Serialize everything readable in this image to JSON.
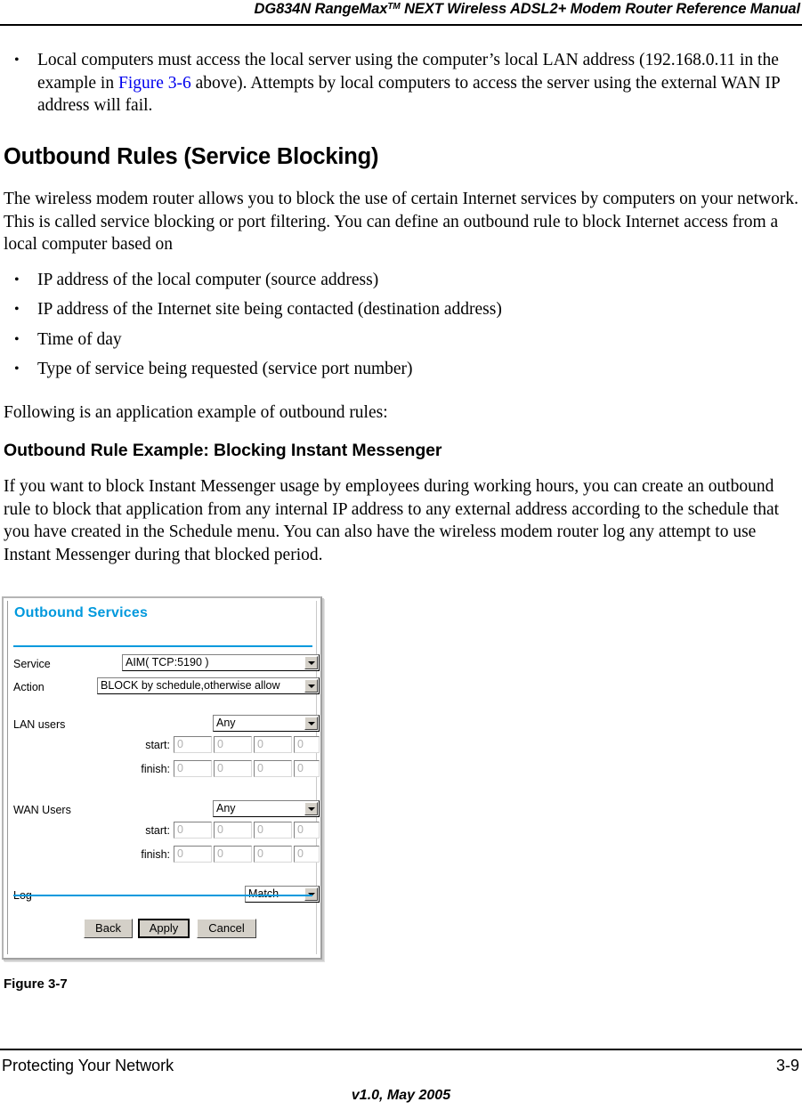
{
  "header": {
    "title_prefix": "DG834N RangeMax",
    "title_sup": "TM",
    "title_suffix": " NEXT Wireless ADSL2+ Modem Router Reference Manual"
  },
  "intro_bullet": {
    "part1": "Local computers must access the local server using the computer’s local LAN address (192.168.0.11 in the example in ",
    "link": "Figure 3-6",
    "part2": " above). Attempts by local computers to access the server using the external WAN IP address will fail."
  },
  "section": {
    "heading": "Outbound Rules (Service Blocking)",
    "intro": "The wireless modem router allows you to block the use of certain Internet services by computers on your network. This is called service blocking or port filtering. You can define an outbound rule to block Internet access from a local computer based on",
    "bullets": [
      "IP address of the local computer (source address)",
      "IP address of the Internet site being contacted (destination address)",
      "Time of day",
      "Type of service being requested (service port number)"
    ],
    "following_line": "Following is an application example of outbound rules:"
  },
  "subsection": {
    "heading": "Outbound Rule Example: Blocking Instant Messenger",
    "paragraph": "If you want to block Instant Messenger usage by employees during working hours, you can create an outbound rule to block that application from any internal IP address to any external address according to the schedule that you have created in the Schedule menu. You can also have the wireless modem router log any attempt to use Instant Messenger during that blocked period."
  },
  "router_ui": {
    "panel_title": "Outbound Services",
    "accent_color": "#0099DD",
    "rows": {
      "service_label": "Service",
      "service_value": "AIM( TCP:5190 )",
      "action_label": "Action",
      "action_value": "BLOCK by schedule,otherwise allow",
      "lan_label": "LAN users",
      "lan_value": "Any",
      "wan_label": "WAN Users",
      "wan_value": "Any",
      "log_label": "Log",
      "log_value": "Match",
      "start_label": "start:",
      "finish_label": "finish:",
      "octet_value": "0",
      "dot": "."
    },
    "buttons": {
      "back": "Back",
      "apply": "Apply",
      "cancel": "Cancel"
    }
  },
  "figure_caption": "Figure 3-7",
  "footer": {
    "left": "Protecting Your Network",
    "right": "3-9",
    "version": "v1.0, May 2005"
  }
}
